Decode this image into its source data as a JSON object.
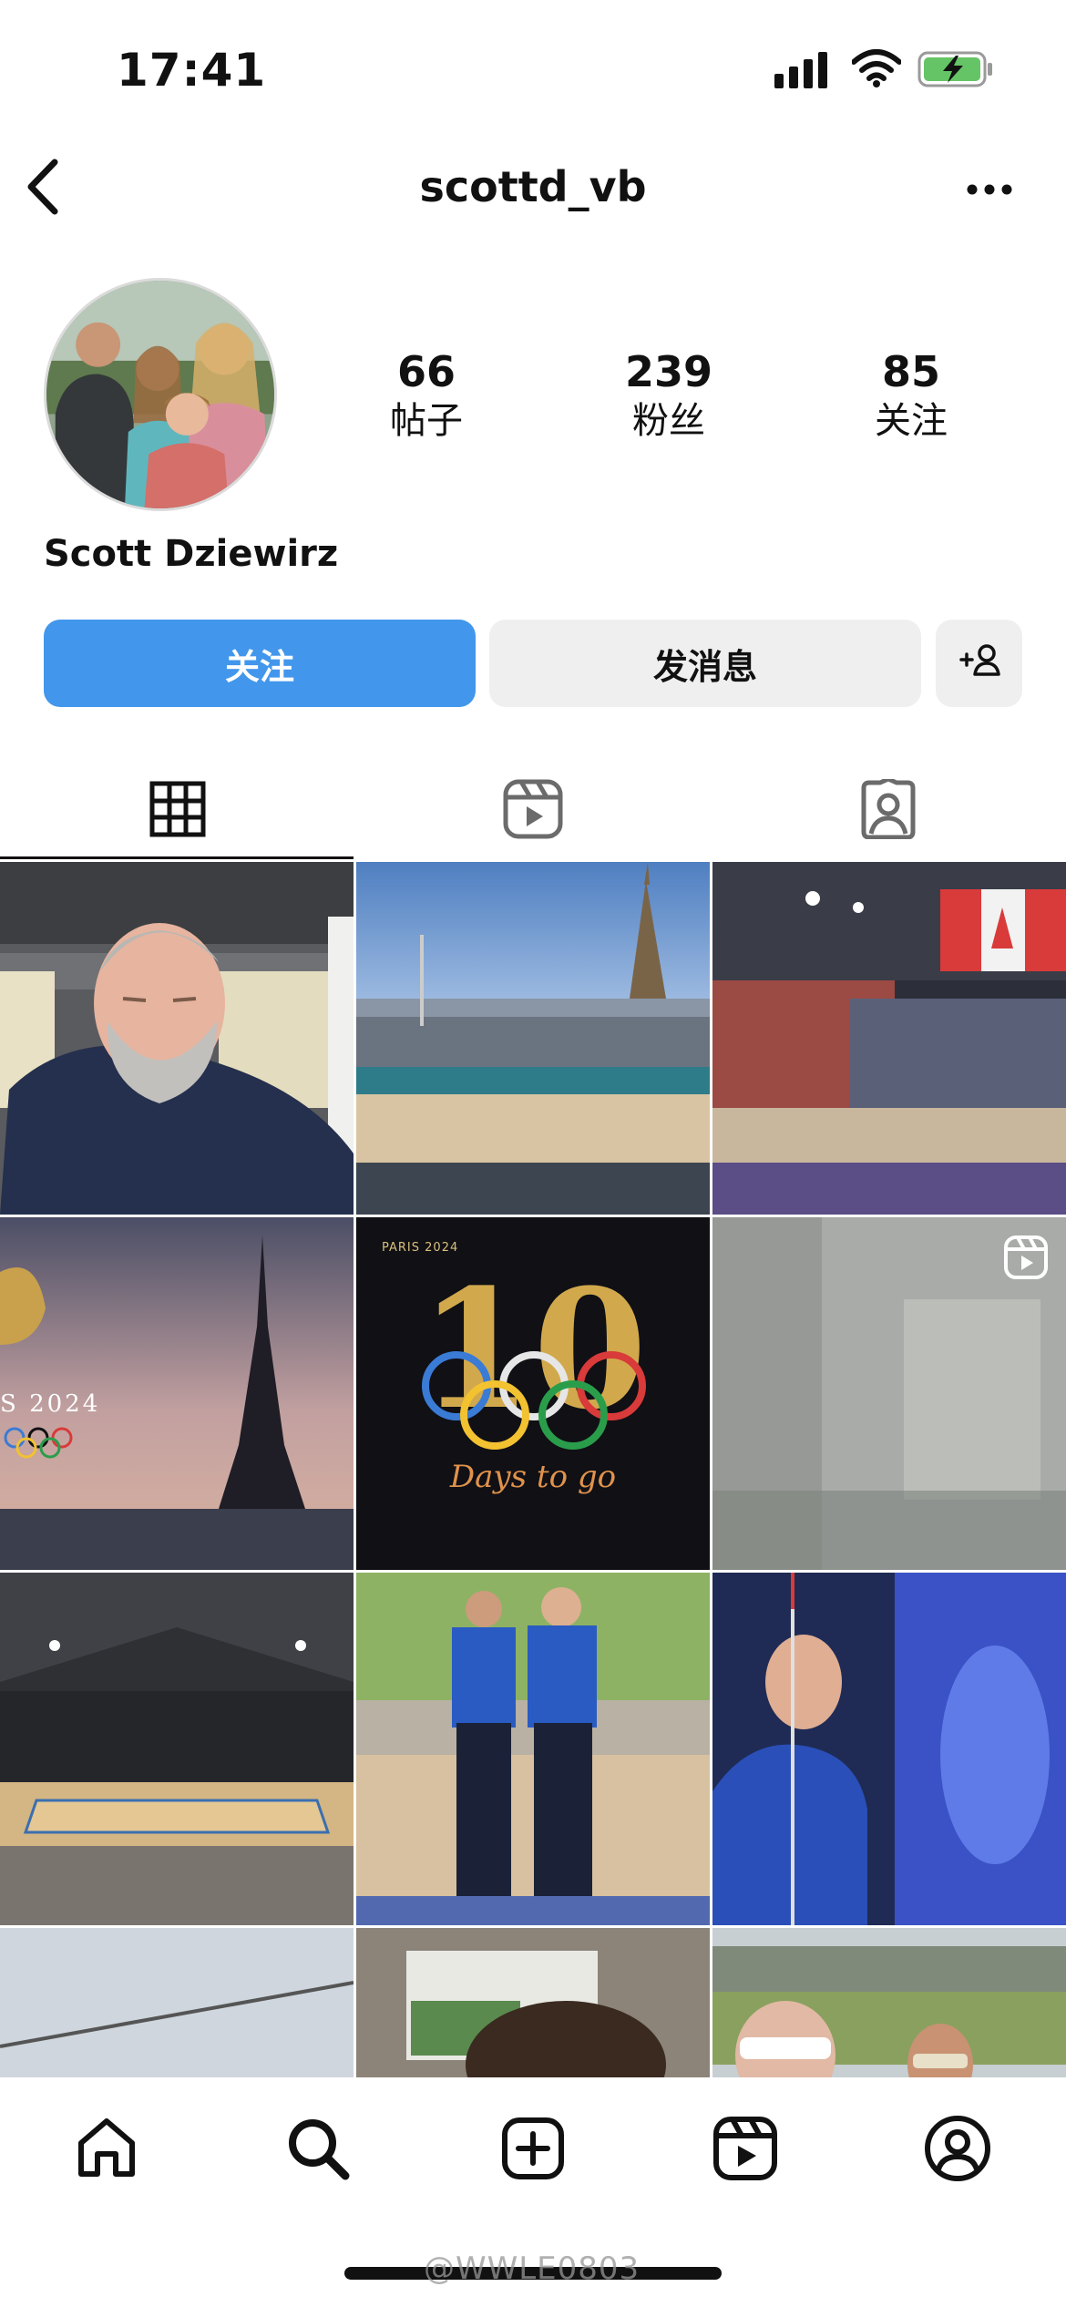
{
  "status_bar": {
    "time": "17:41",
    "icons": [
      "signal-icon",
      "wifi-icon",
      "battery-charging-icon"
    ],
    "battery_color": "#65c466"
  },
  "header": {
    "username": "scottd_vb",
    "icons": [
      "back-chevron-icon",
      "more-options-icon"
    ]
  },
  "profile": {
    "full_name": "Scott Dziewirz",
    "stats": [
      {
        "value": "66",
        "label": "帖子"
      },
      {
        "value": "239",
        "label": "粉丝"
      },
      {
        "value": "85",
        "label": "关注"
      }
    ]
  },
  "actions": {
    "follow_label": "关注",
    "message_label": "发消息",
    "suggest_icon": "add-person-icon",
    "follow_color": "#4297ec"
  },
  "tabs": [
    {
      "name": "posts-grid",
      "icon": "grid-icon",
      "active": true
    },
    {
      "name": "reels",
      "icon": "reels-icon",
      "active": false
    },
    {
      "name": "tagged",
      "icon": "tagged-person-icon",
      "active": false
    }
  ],
  "posts": {
    "olympic_graphic": {
      "paris_label": "PARIS 2024",
      "partial_text": "S 2024",
      "big_number": "10",
      "tagline": "Days to go"
    },
    "reel_icon": "reel-badge-icon"
  },
  "bottom_nav": {
    "items": [
      "home-icon",
      "search-icon",
      "create-icon",
      "reels-icon",
      "profile-icon"
    ]
  },
  "watermark": "@WWLE0803"
}
